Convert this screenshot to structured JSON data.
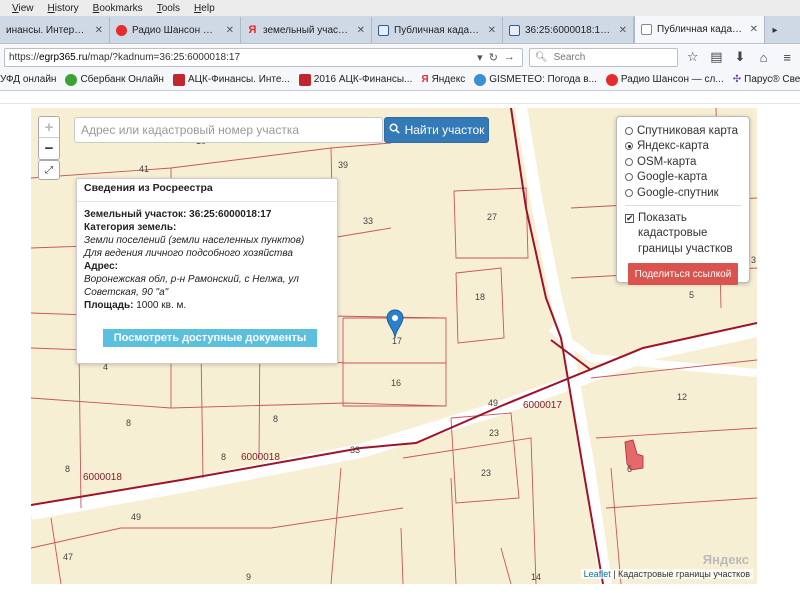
{
  "menubar": [
    "View",
    "History",
    "Bookmarks",
    "Tools",
    "Help"
  ],
  "tabs": [
    {
      "label": "инансы. Интернет-...",
      "icon_color": "#888888",
      "active": false
    },
    {
      "label": "Радио Шансон — слуш...",
      "icon_color": "#e52b2b",
      "active": false
    },
    {
      "label": "земельный участок во...",
      "icon_color": "#e52b2b",
      "active": false
    },
    {
      "label": "Публичная кадастров...",
      "icon_color": "#2b5aa8",
      "active": false
    },
    {
      "label": "36:25:6000018:17 - Во...",
      "icon_color": "#2b5aa8",
      "active": false
    },
    {
      "label": "Публичная кадастров...",
      "icon_color": "#8a8a8a",
      "active": true
    }
  ],
  "navbar": {
    "url_prefix": "https://",
    "url_host": "egrp365.ru",
    "url_path": "/map/?kadnum=36:25:6000018:17",
    "search_placeholder": "Search"
  },
  "bookmarks": [
    {
      "label": "УФД онлайн",
      "icon_color": "#4a8fd1"
    },
    {
      "label": "Сбербанк Онлайн",
      "icon_color": "#3aa335"
    },
    {
      "label": "АЦК-Финансы. Инте...",
      "icon_color": "#c0262d"
    },
    {
      "label": "2016  АЦК-Финансы...",
      "icon_color": "#c0262d"
    },
    {
      "label": "Яндекс",
      "icon_color": "#e52b2b"
    },
    {
      "label": "GISMETEO: Погода в...",
      "icon_color": "#3b8fd0"
    },
    {
      "label": "Радио Шансон — сл...",
      "icon_color": "#e52b2b"
    },
    {
      "label": "Парус® Сведение о...",
      "icon_color": "#6a3aa0"
    }
  ],
  "map": {
    "search_placeholder": "Адрес или кадастровый номер участка",
    "find_button": "Найти участок",
    "zoom_in": "+",
    "zoom_out": "−",
    "layers": [
      {
        "label": "Спутниковая карта",
        "selected": false
      },
      {
        "label": "Яндекс-карта",
        "selected": true
      },
      {
        "label": "OSM-карта",
        "selected": false
      },
      {
        "label": "Google-карта",
        "selected": false
      },
      {
        "label": "Google-спутник",
        "selected": false
      }
    ],
    "show_borders": {
      "checked": true,
      "label": "Показать кадастровые границы участков"
    },
    "share_button": "Поделиться ссылкой",
    "info": {
      "title": "Сведения из Росреестра",
      "parcel_label": "Земельный участок:",
      "parcel_number": "36:25:6000018:17",
      "category_label": "Категория земель:",
      "category_value": "Земли поселений (земли населенных пунктов)",
      "usage_value": "Для ведения личного подсобного хозяйства",
      "address_label": "Адрес:",
      "address_line1": "Воронежская обл, р-н Рамонский, с Нелжа, ул",
      "address_line2": "Советская, 90 \"а\"",
      "area_label": "Площадь:",
      "area_value": "1000 кв. м.",
      "docs_button": "Посмотреть доступные документы"
    },
    "attribution_link": "Leaflet",
    "attribution_text": " | Кадастровые границы участков",
    "provider_mark": "Яндекс",
    "labels": {
      "q1": "6000017",
      "q2": "6000018",
      "q3": "6000018",
      "p27": "27",
      "p18": "18",
      "p17": "17",
      "p16": "16",
      "p5": "5",
      "p4": "4",
      "p3": "3",
      "p12": "12",
      "p23a": "23",
      "p23b": "23",
      "p8a": "8",
      "p8b": "8",
      "p8c": "8",
      "p8d": "8",
      "p33a": "33",
      "p33b": "33",
      "p39": "39",
      "p49a": "49",
      "p49b": "49",
      "p14": "14",
      "p47": "47",
      "p41": "41",
      "p10": "10",
      "p9": "9",
      "p6": "6"
    }
  }
}
